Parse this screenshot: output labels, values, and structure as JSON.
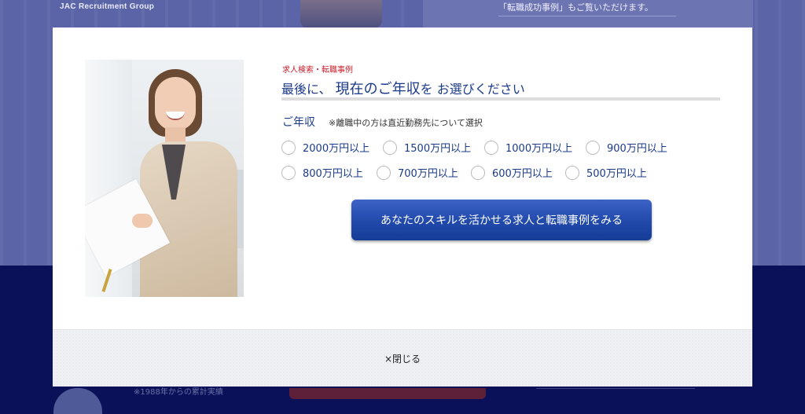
{
  "background": {
    "brand": "JAC Recruitment Group",
    "notice": "「転職成功事例」もご覧いただけます。",
    "stat": "※1988年からの累計実績"
  },
  "modal": {
    "kicker": "求人検索・転職事例",
    "headline": {
      "prefix": "最後に、",
      "emphasis": "現在のご年収",
      "particle": "を",
      "suffix": "お選びください"
    },
    "income_label": "ご年収",
    "income_note": "※離職中の方は直近勤務先について選択",
    "options_row1": [
      "2000万円以上",
      "1500万円以上",
      "1000万円以上",
      "900万円以上"
    ],
    "options_row2": [
      "800万円以上",
      "700万円以上",
      "600万円以上",
      "500万円以上"
    ],
    "cta_label": "あなたのスキルを活かせる求人と転職事例をみる",
    "close_label": "×閉じる"
  },
  "colors": {
    "accent": "#1b3a8a",
    "kicker": "#cc1e2a",
    "cta": "#2049aa"
  }
}
